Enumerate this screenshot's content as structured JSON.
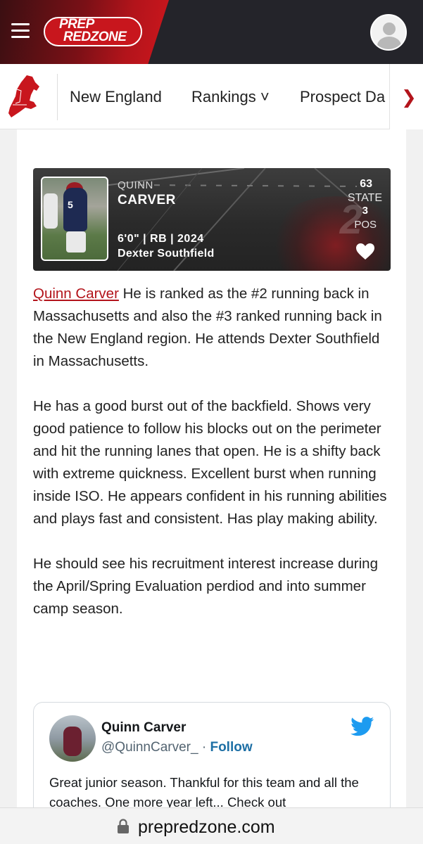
{
  "header": {
    "logo_line1": "PREP",
    "logo_line2": "REDZONE"
  },
  "subnav": {
    "items": [
      {
        "label": "New England"
      },
      {
        "label": "Rankings ˅"
      },
      {
        "label": "Prospect Da"
      }
    ]
  },
  "player_card": {
    "first_name": "QUINN",
    "last_name": "CARVER",
    "info": "6'0\" | RB | 2024",
    "school": "Dexter Southfield",
    "state_rank": "63",
    "state_label": "STATE",
    "pos_rank": "3",
    "pos_label": "POS",
    "watermark_rank": "2"
  },
  "article": {
    "p1_link": "Quinn Carver",
    "p1_text": " He is ranked as the #2 running back in Massachusetts and also the #3 ranked running back in the New England region. He attends Dexter Southfield in Massachusetts.",
    "p2": "He has a good burst out of the backfield.  Shows very good patience to follow his blocks out on the perimeter and hit the running lanes that open. He is a shifty back with extreme quickness. Excellent burst when running inside ISO.  He appears confident in his running abilities and plays fast and consistent. Has play making ability.",
    "p3": "He should see his recruitment interest increase during the April/Spring Evaluation perdiod and into summer camp season."
  },
  "tweet": {
    "name": "Quinn Carver",
    "handle": "@QuinnCarver_",
    "separator": " · ",
    "follow": "Follow",
    "text": "Great junior season. Thankful for this team and all the coaches. One more year left... Check out"
  },
  "browser": {
    "url": "prepredzone.com"
  },
  "colors": {
    "brand_red": "#c8161d",
    "header_dark": "#24242a",
    "link_red": "#b3141b",
    "twitter_blue": "#1d9bf0"
  }
}
